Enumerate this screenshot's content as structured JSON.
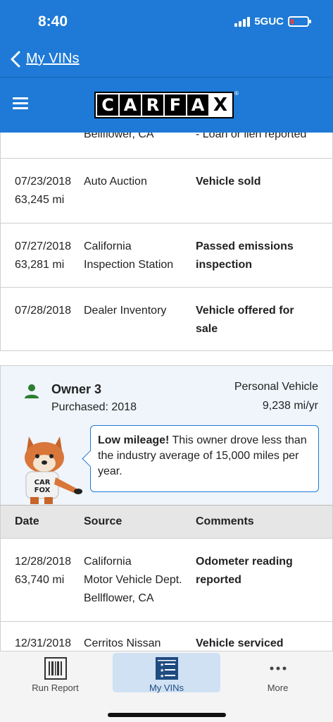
{
  "status_bar": {
    "time": "8:40",
    "network": "5GUC"
  },
  "nav": {
    "back_label": "My VINs"
  },
  "header": {
    "logo_letters": [
      "C",
      "A",
      "R",
      "F",
      "A",
      "X"
    ]
  },
  "prev_rows": [
    {
      "date": "",
      "odometer": "",
      "source_lines": [
        "Bellflower, CA"
      ],
      "comment": "- Loan or lien reported",
      "comment_bold": false
    },
    {
      "date": "07/23/2018",
      "odometer": "63,245 mi",
      "source_lines": [
        "Auto Auction"
      ],
      "comment": "Vehicle sold",
      "comment_bold": true
    },
    {
      "date": "07/27/2018",
      "odometer": "63,281 mi",
      "source_lines": [
        "California",
        "Inspection Station"
      ],
      "comment": "Passed emissions inspection",
      "comment_bold": true
    },
    {
      "date": "07/28/2018",
      "odometer": "",
      "source_lines": [
        "Dealer Inventory"
      ],
      "comment": "Vehicle offered for sale",
      "comment_bold": true
    }
  ],
  "owner": {
    "title": "Owner 3",
    "purchased": "Purchased: 2018",
    "type": "Personal Vehicle",
    "mileage": "9,238 mi/yr",
    "bubble_bold": "Low mileage!",
    "bubble_text": " This owner drove less than the industry average of 15,000 miles per year."
  },
  "table": {
    "headers": {
      "date": "Date",
      "source": "Source",
      "comments": "Comments"
    },
    "rows": [
      {
        "date": "12/28/2018",
        "odometer": "63,740 mi",
        "source_lines": [
          "California",
          "Motor Vehicle Dept.",
          "Bellflower, CA"
        ],
        "comment": "Odometer reading reported"
      },
      {
        "date": "12/31/2018",
        "odometer": "",
        "source_lines": [
          "Cerritos Nissan"
        ],
        "comment": "Vehicle serviced"
      }
    ]
  },
  "tabs": [
    {
      "label": "Run Report",
      "icon": "barcode-icon",
      "active": false
    },
    {
      "label": "My VINs",
      "icon": "list-icon",
      "active": true
    },
    {
      "label": "More",
      "icon": "more-icon",
      "active": false
    }
  ],
  "colors": {
    "brand_blue": "#1e7ad6",
    "owner_bg": "#eff5fb",
    "person_icon": "#2e7d32"
  }
}
